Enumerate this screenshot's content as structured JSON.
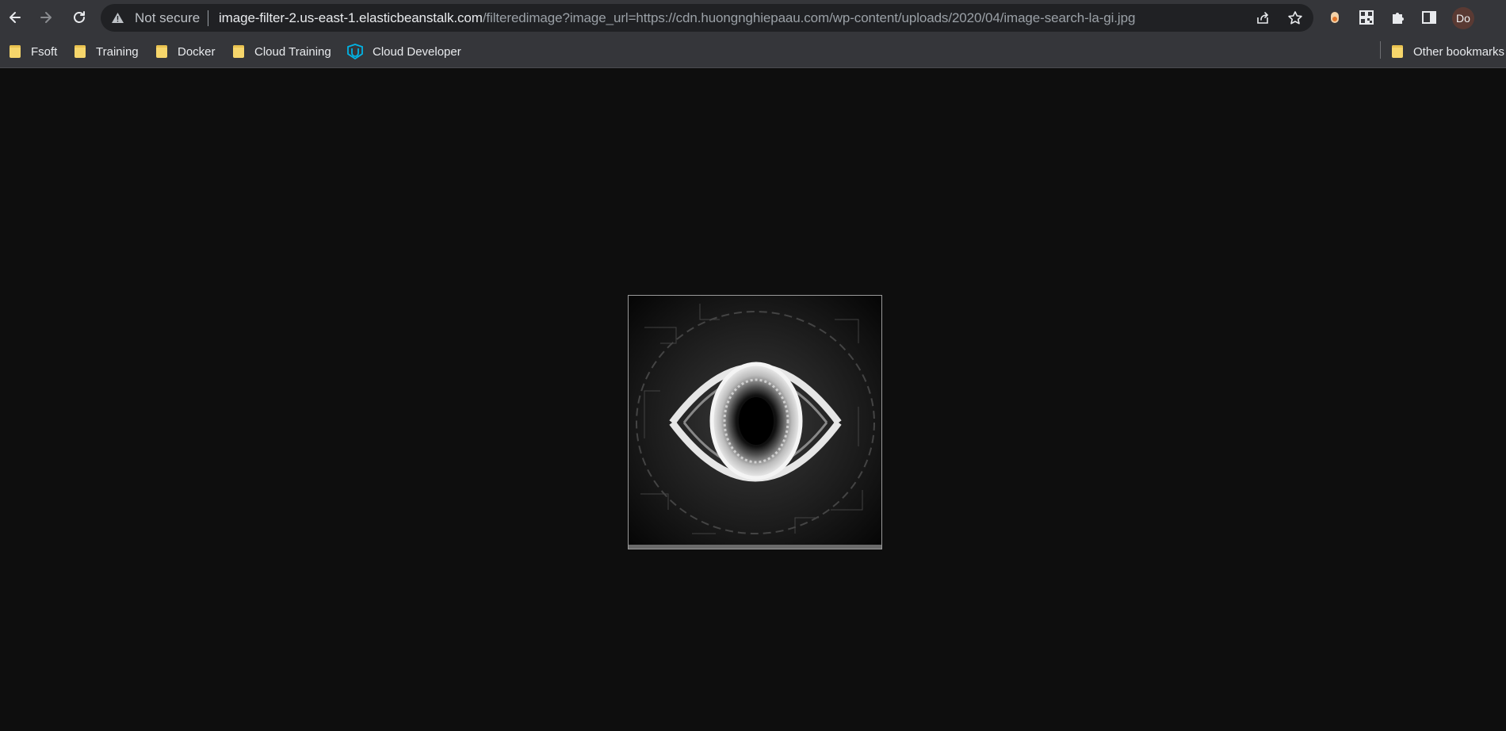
{
  "browser": {
    "security_label": "Not secure",
    "url_host": "image-filter-2.us-east-1.elasticbeanstalk.com",
    "url_path": "/filteredimage?image_url=https://cdn.huongnghiepaau.com/wp-content/uploads/2020/04/image-search-la-gi.jpg",
    "profile_initials": "Do"
  },
  "bookmarks": [
    {
      "label": "Fsoft",
      "icon": "folder-icon"
    },
    {
      "label": "Training",
      "icon": "folder-icon"
    },
    {
      "label": "Docker",
      "icon": "folder-icon"
    },
    {
      "label": "Cloud Training",
      "icon": "folder-icon"
    },
    {
      "label": "Cloud Developer",
      "icon": "udacity-icon"
    }
  ],
  "other_bookmarks": "Other bookmarks",
  "content": {
    "image_description_icon": "eye-icon"
  },
  "colors": {
    "page_background": "#0e0e0e",
    "toolbar": "#35363a",
    "omnibox": "#202124",
    "folder": "#f6d66b",
    "udacity": "#02b3e4"
  }
}
